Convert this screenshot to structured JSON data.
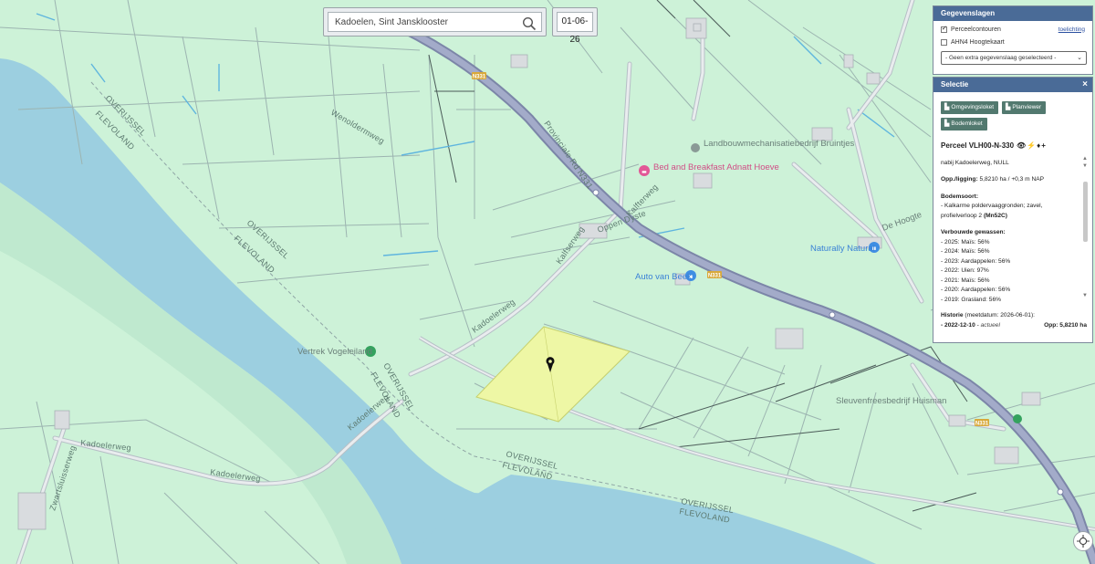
{
  "search": {
    "value": "Kadoelen, Sint Jansklooster"
  },
  "date": {
    "value": "01-06-26"
  },
  "layers": {
    "title": "Gegevenslagen",
    "items": [
      {
        "label": "Perceelcontouren",
        "checked": true,
        "link": "toelichting"
      },
      {
        "label": "AHN4 Hoogtekaart",
        "checked": false
      }
    ],
    "select_value": "- Geen extra gegevenslaag geselecteerd -"
  },
  "selection": {
    "title": "Selectie",
    "close": "×",
    "buttons": [
      "Omgevingsloket",
      "Planviewer",
      "Bodemloket"
    ],
    "perceel_title": "Perceel VLH00-N-330",
    "location": "nabij Kadoelerweg, NULL",
    "opp_label": "Opp./ligging:",
    "opp_value": "5,8210 ha / +0,3 m NAP",
    "bodem_label": "Bodemsoort:",
    "bodem_line1": "- Kalkarme poldervaaggronden; zavel,",
    "bodem_line2": "profielverloop 2",
    "bodem_code": "(Mn52C)",
    "gewassen_label": "Verbouwde gewassen:",
    "gewassen": [
      "- 2025: Maïs: 56%",
      "- 2024: Maïs: 56%",
      "- 2023: Aardappelen: 56%",
      "- 2022: Uien: 97%",
      "- 2021: Maïs: 56%",
      "- 2020: Aardappelen: 56%",
      "- 2019: Grasland: 56%"
    ],
    "historie_label": "Historie",
    "historie_sub": "(meetdatum: 2026-06-01):",
    "hist_date": "- 2022-12-10",
    "hist_status": "actueel",
    "hist_opp": "Opp: 5,8210 ha"
  },
  "map": {
    "colors": {
      "land": "#cdf2d8",
      "water": "#9ccfe0",
      "road": "#8e97b8",
      "parcel": "#eef7a5"
    },
    "road_labels": [
      "Provinciale Rd N331",
      "Kadoelerweg",
      "Kalfserweg",
      "Kadoelerweg",
      "Kadoelerweg",
      "Kadoelerweg",
      "Zwartsluisserweg",
      "Wenoldermweg",
      "Kalfterweg",
      "Oppen Dyste"
    ],
    "road_numbers": [
      "N331",
      "N331",
      "N331"
    ],
    "region_labels": [
      "OVERIJSSEL",
      "FLEVOLAND"
    ],
    "poi": [
      {
        "name": "Landbouwmechanisatiebedrijf Bruintjes",
        "icon": "pin-icon"
      },
      {
        "name": "Bed and Breakfast Adnatt Hoeve",
        "icon": "bed-icon"
      },
      {
        "name": "Auto van Beek",
        "icon": "car-icon"
      },
      {
        "name": "Naturally Natural",
        "icon": "shop-icon"
      },
      {
        "name": "Vertrek Vogeleiland",
        "icon": "ferry-icon"
      },
      {
        "name": "Sleuvenfreesbedrijf Huisman",
        "icon": "pin-icon"
      },
      {
        "name": "De Hoogte",
        "icon": ""
      }
    ]
  }
}
